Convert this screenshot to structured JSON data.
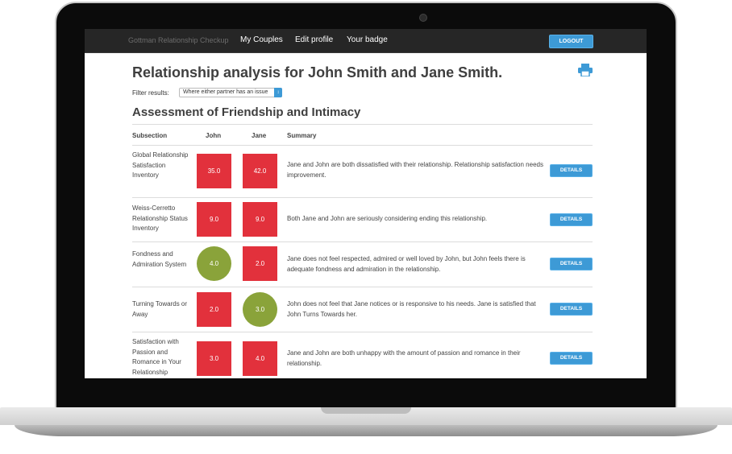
{
  "nav": {
    "brand": "Gottman Relationship Checkup",
    "links": [
      "My Couples",
      "Edit profile",
      "Your badge"
    ],
    "logout_label": "LOGOUT"
  },
  "page": {
    "title": "Relationship analysis for John Smith and Jane Smith.",
    "filter_label": "Filter results:",
    "filter_value": "Where either partner has an issue",
    "section_title": "Assessment of Friendship and Intimacy"
  },
  "table": {
    "headers": [
      "Subsection",
      "John",
      "Jane",
      "Summary"
    ],
    "details_label": "DETAILS",
    "rows": [
      {
        "label": "Global Relationship Satisfaction Inventory",
        "john": "35.0",
        "john_status": "issue",
        "jane": "42.0",
        "jane_status": "issue",
        "summary": "Jane and John are both dissatisfied with their relationship. Relationship satisfaction needs improvement."
      },
      {
        "label": "Weiss-Cerretto Relationship Status Inventory",
        "john": "9.0",
        "john_status": "issue",
        "jane": "9.0",
        "jane_status": "issue",
        "summary": "Both Jane and John are seriously considering ending this relationship."
      },
      {
        "label": "Fondness and Admiration System",
        "john": "4.0",
        "john_status": "ok",
        "jane": "2.0",
        "jane_status": "issue",
        "summary": "Jane does not feel respected, admired or well loved by John, but John feels there is adequate fondness and admiration in the relationship."
      },
      {
        "label": "Turning Towards or Away",
        "john": "2.0",
        "john_status": "issue",
        "jane": "3.0",
        "jane_status": "ok",
        "summary": "John does not feel that Jane notices or is responsive to his needs. Jane is satisfied that John Turns Towards her."
      },
      {
        "label": "Satisfaction with Passion and Romance in Your Relationship",
        "john": "3.0",
        "john_status": "issue",
        "jane": "4.0",
        "jane_status": "issue",
        "summary": "Jane and John are both unhappy with the amount of passion and romance in their relationship."
      }
    ]
  },
  "colors": {
    "issue": "#e2313c",
    "ok": "#8aa33a",
    "accent": "#3d9ad6"
  },
  "icons": {
    "print": "printer-icon"
  }
}
